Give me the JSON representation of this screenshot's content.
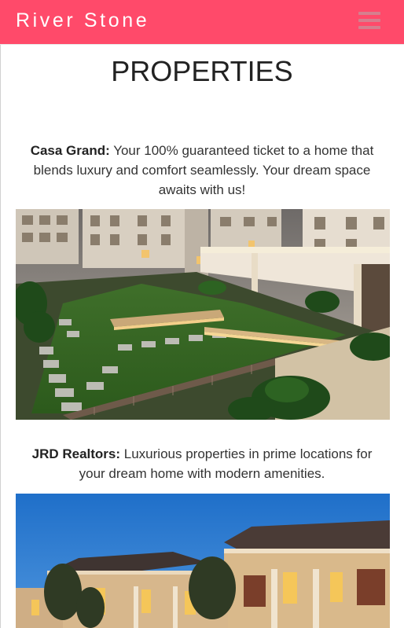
{
  "navbar": {
    "brand": "River Stone",
    "menu_icon": "hamburger-menu-icon"
  },
  "main": {
    "title": "PROPERTIES",
    "properties": [
      {
        "name": "Casa Grand:",
        "description": " Your 100% guaranteed ticket to a home that blends luxury and comfort seamlessly. Your dream space awaits with us!"
      },
      {
        "name": "JRD Realtors:",
        "description": " Luxurious properties in prime locations for your dream home with modern amenities."
      }
    ]
  },
  "colors": {
    "navbar_bg": "#ff4a6a",
    "brand_text": "#ffffff",
    "menu_icon": "#d57f8e"
  }
}
